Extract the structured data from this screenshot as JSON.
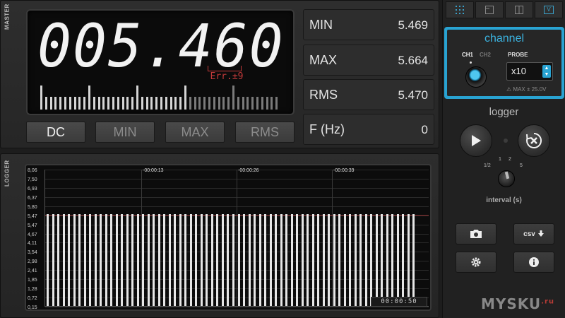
{
  "master": {
    "side_label": "MASTER",
    "reading": "005.460",
    "error_label": "Err.±9",
    "bargraph_level": 0.62,
    "mode_buttons": [
      "DC",
      "MIN",
      "MAX",
      "RMS"
    ],
    "active_mode": "DC",
    "stats": [
      {
        "label": "MIN",
        "value": "5.469"
      },
      {
        "label": "MAX",
        "value": "5.664"
      },
      {
        "label": "RMS",
        "value": "5.470"
      },
      {
        "label": "F (Hz)",
        "value": "0"
      }
    ]
  },
  "logger_panel": {
    "side_label": "LOGGER",
    "y_ticks": [
      "8,06",
      "7,50",
      "6,93",
      "6,37",
      "5,80",
      "5,47",
      "5,47",
      "4,67",
      "4,11",
      "3,54",
      "2,98",
      "2,41",
      "1,85",
      "1,28",
      "0,72",
      "0,15"
    ],
    "time_marks": [
      "-00:00:13",
      "-00:00:26",
      "-00:00:39"
    ],
    "timer": "00:00:50",
    "colors": {
      "bar": "#e6e6e6",
      "reference_line": "#8a2b2b"
    }
  },
  "chart_data": {
    "type": "bar",
    "ylim": [
      0.15,
      8.06
    ],
    "reference_value": 5.47,
    "x": [
      "-00:00:13",
      "-00:00:26",
      "-00:00:39"
    ],
    "values": [
      5.47,
      5.47,
      5.47,
      5.47,
      5.47,
      5.47,
      5.47,
      5.47,
      5.47,
      5.47,
      5.47,
      5.47,
      5.47,
      5.47,
      5.47,
      5.47,
      5.47,
      5.47,
      5.47,
      5.47,
      5.47,
      5.47,
      5.47,
      5.47,
      5.47,
      5.47,
      5.47,
      5.47,
      5.47,
      5.47,
      5.47,
      5.47,
      5.47,
      5.47,
      5.47,
      5.47,
      5.47,
      5.47,
      5.47,
      5.47,
      5.47,
      5.47,
      5.47,
      5.47,
      5.47,
      5.47,
      5.47,
      5.47,
      5.47,
      5.47,
      5.47,
      5.47,
      5.47,
      5.47,
      5.47,
      5.47,
      5.47,
      5.47,
      5.47,
      5.47,
      5.47,
      5.47,
      5.47,
      5.47,
      5.47,
      5.47,
      5.47,
      5.47,
      5.47,
      5.47
    ]
  },
  "right_panel": {
    "top_buttons": [
      {
        "icon": "grid-icon"
      },
      {
        "icon": "single-view-icon"
      },
      {
        "icon": "split-view-icon"
      },
      {
        "icon": "v-mode-icon",
        "label": "V"
      }
    ],
    "channel": {
      "title": "channel",
      "ch1": "CH1",
      "ch2": "CH2",
      "probe_label": "PROBE",
      "probe_value": "x10",
      "max_warning": "MAX ± 25.0V",
      "accent": "#29a3d2"
    },
    "logger": {
      "title": "logger",
      "interval_ticks": [
        "1/2",
        "1",
        "2",
        "5"
      ],
      "interval_label": "interval (s)"
    },
    "actions": [
      {
        "icon": "camera-icon"
      },
      {
        "icon": "csv-download-icon",
        "label": "csv"
      },
      {
        "icon": "gear-icon"
      },
      {
        "icon": "info-icon"
      }
    ],
    "watermark": "MYSKU",
    "watermark_suffix": ".ru"
  }
}
